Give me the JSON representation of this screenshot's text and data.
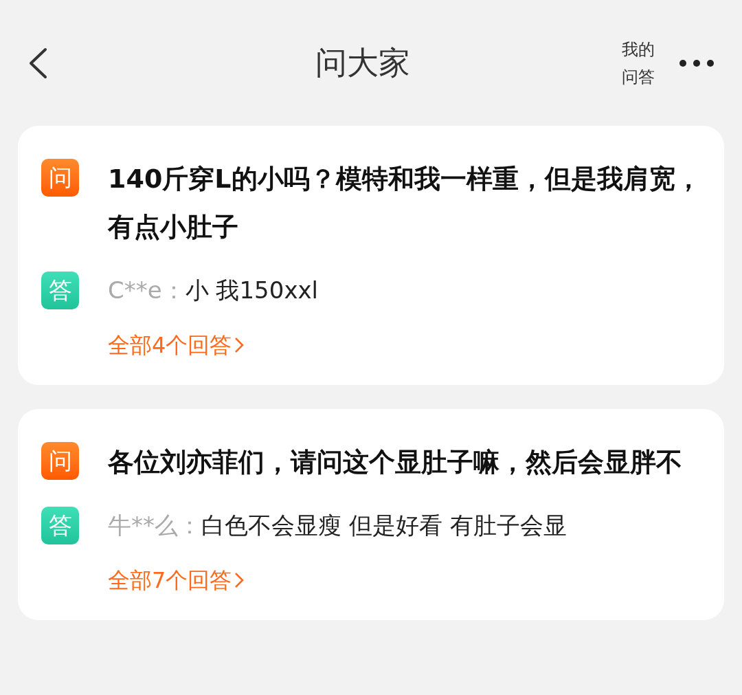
{
  "header": {
    "title": "问大家",
    "my_qa": "我的问答"
  },
  "questions": [
    {
      "question_badge": "问",
      "question": "140斤穿L的小吗？模特和我一样重，但是我肩宽，有点小肚子",
      "answer_badge": "答",
      "user": "C**e：",
      "answer": "小 我150xxl",
      "all_answers": "全部4个回答"
    },
    {
      "question_badge": "问",
      "question": "各位刘亦菲们，请问这个显肚子嘛，然后会显胖不",
      "answer_badge": "答",
      "user": "牛**么：",
      "answer": "白色不会显瘦 但是好看 有肚子会显",
      "all_answers": "全部7个回答"
    }
  ]
}
